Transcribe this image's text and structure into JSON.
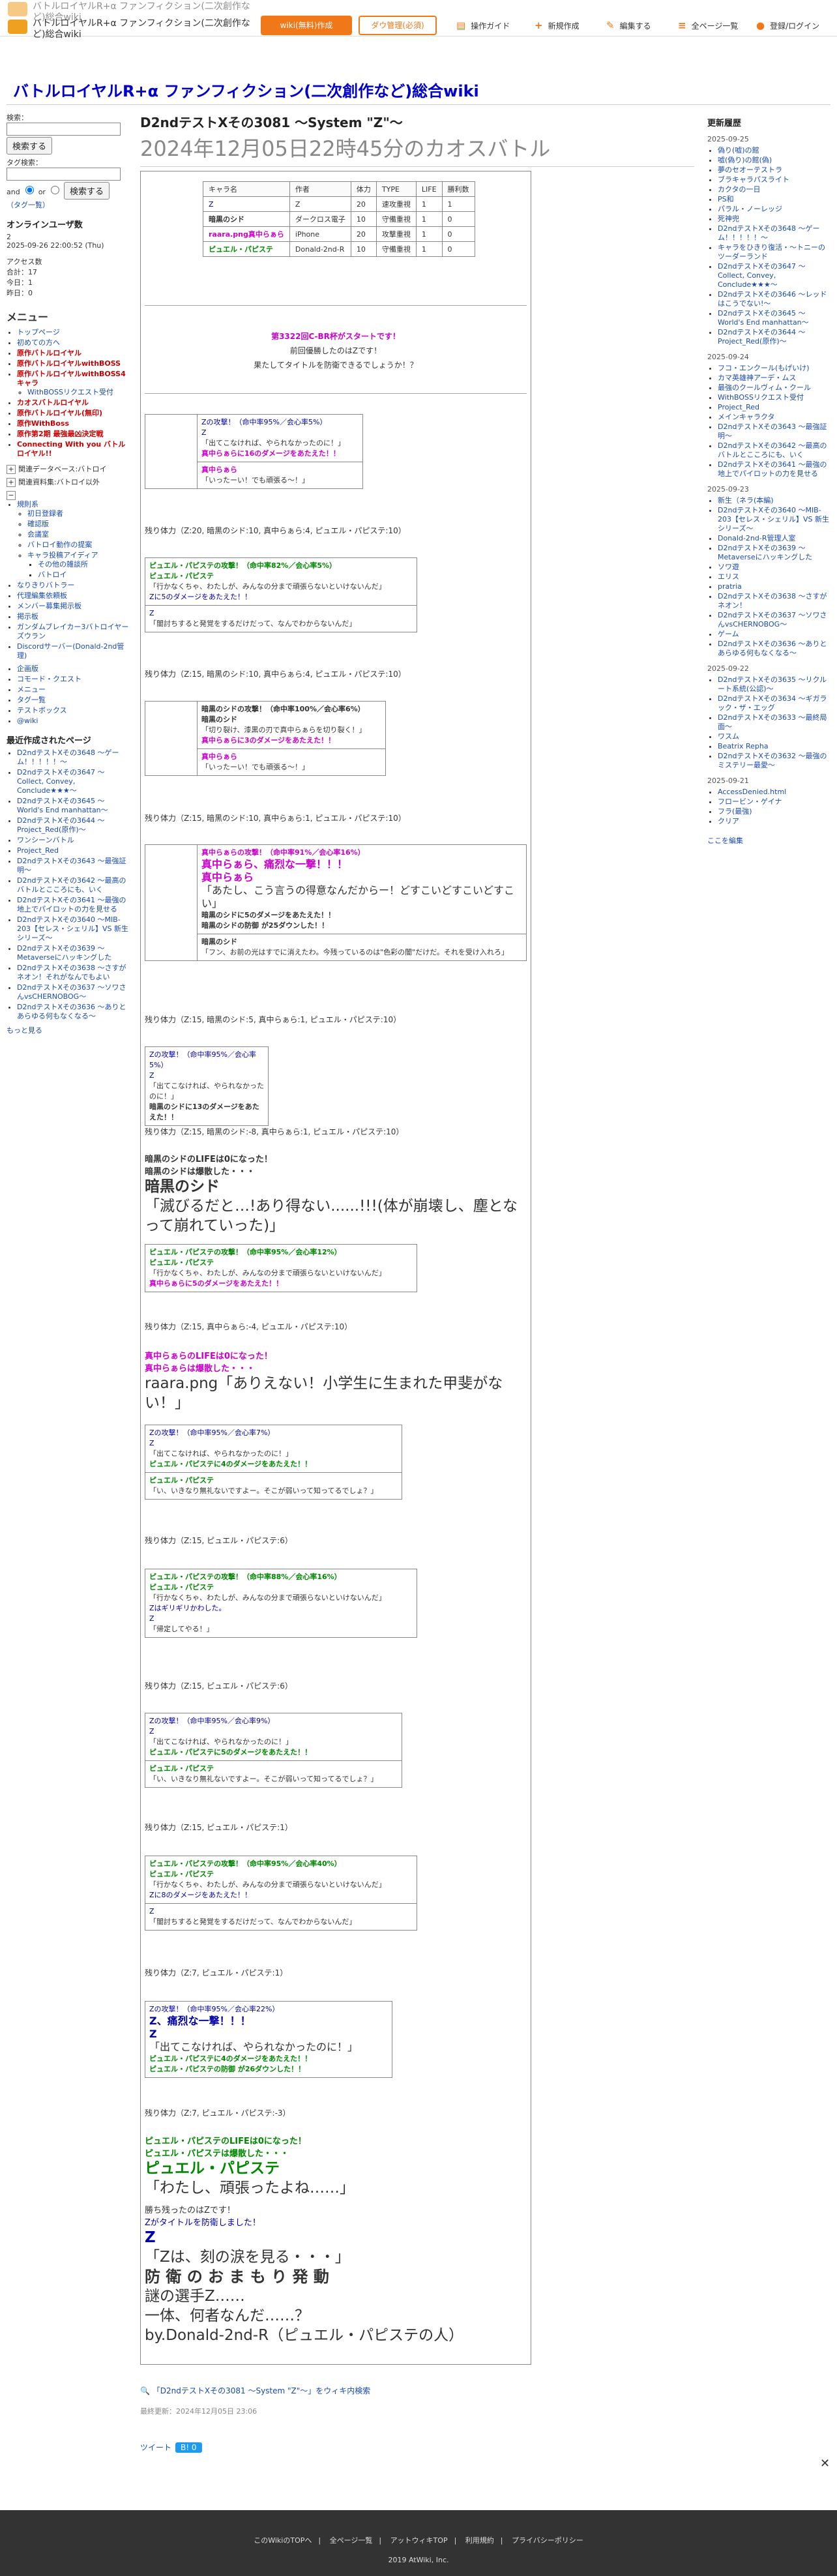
{
  "header": {
    "site_name": "バトルロイヤルR+α ファンフィクション(二次創作など)総合wiki",
    "wiki_new": "wiki(無料)作成",
    "admin": "ダウ管理(必須)",
    "guide": "操作ガイド",
    "new_page": "新規作成",
    "edit": "編集する",
    "all_pages": "全ページ一覧",
    "login": "登録/ログイン"
  },
  "site_title": "バトルロイヤルR+α ファンフィクション(二次創作など)総合wiki",
  "left": {
    "search_label": "検索：",
    "search_button": "検索する",
    "tag_search_label": "タグ検索：",
    "and": "and",
    "or": "or",
    "tag_search_button": "検索する",
    "tag_list": "（タグ一覧）",
    "online_title": "オンラインユーザ数",
    "online_count": "2",
    "online_time": "2025-09-26 22:00:52 (Thu)",
    "access_title": "アクセス数",
    "access_total": "合計：17",
    "access_today": "今日：1",
    "access_yesterday": "昨日：0",
    "menu_title": "メニュー",
    "menu_items": [
      "トップページ",
      "初めての方へ",
      "原作バトルロイヤル",
      "原作バトルロイヤルwithBOSS",
      "原作バトルロイヤルwithBOSS4キャラ",
      "WithBOSSリクエスト受付",
      "カオスバトルロイヤル",
      "原作バトルロイヤル(無印)",
      "原作WithBoss",
      "原作第2期 最強最凶決定戦",
      "Connecting With you バトルロイヤル!!"
    ],
    "menu_related1": "関連データベース:バトロイ",
    "menu_related2": "関連資料集:バトロイ以外",
    "fold_items": [
      "規則系",
      "初日登録者",
      "確認版",
      "会議室",
      "バトロイ動作の提案",
      "キャラ投稿アイディア",
      "その他の雑談所",
      "バトロイ"
    ],
    "misc_items": [
      "なりきりバトラー",
      "代理編集依頼板",
      "メンバー募集掲示板",
      "掲示板",
      "ガンダムブレイカー3バトロイヤーズウラン",
      "Discordサーバー(Donald-2nd管理)"
    ],
    "bottom_items": [
      "企画版",
      "コモード・クエスト",
      "メニュー",
      "タグ一覧",
      "テストボックス",
      "@wiki"
    ],
    "recent_title": "最近作成されたページ",
    "recent_items": [
      "D2ndテストXその3648 〜ゲーム！！！！！〜",
      "D2ndテストXその3647 〜Collect, Convey, Conclude★★★〜",
      "D2ndテストXその3645 〜World's End manhattan〜",
      "D2ndテストXその3644 〜Project_Red(原作)〜",
      "ワンシーンバトル",
      "Project_Red",
      "D2ndテストXその3643 〜最強証明〜",
      "D2ndテストXその3642 〜最高のバトルとこころにも、いく",
      "D2ndテストXその3641 〜最強の地上でパイロットの力を見せる",
      "D2ndテストXその3640 〜MIB-203【セレス・シェリル】VS 新生シリーズ〜",
      "D2ndテストXその3639 〜Metaverseにハッキングした",
      "D2ndテストXその3638 〜さすがネオン！それがなんでもよい",
      "D2ndテストXその3637 〜ソワさんvsCHERNOBOG〜",
      "D2ndテストXその3636 〜ありとあらゆる何もなくなる〜"
    ],
    "more": "もっと見る"
  },
  "page": {
    "title_en": "D2ndテストXその3081 〜System \"Z\"〜",
    "title_jp": "2024年12月05日22時45分のカオスバトル"
  },
  "stats_table": {
    "headers": [
      "キャラ名",
      "作者",
      "体力",
      "TYPE",
      "LIFE",
      "勝利数"
    ],
    "rows": [
      [
        "Z",
        "Z",
        "20",
        "速攻重視",
        "1",
        "1"
      ],
      [
        "暗黒のシド",
        "ダークロス電子",
        "10",
        "守備重視",
        "1",
        "0"
      ],
      [
        "raara.png真中らぁら",
        "iPhone",
        "20",
        "攻撃重視",
        "1",
        "0"
      ],
      [
        "ピュエル・パピステ",
        "Donald-2nd-R",
        "10",
        "守備重視",
        "1",
        "0"
      ]
    ]
  },
  "intro": {
    "line1": "第3322回C-BR杯がスタートです！",
    "line2": "前回優勝したのはZです！",
    "line3": "果たしてタイトルを防衛できるでしょうか！？"
  },
  "battle": {
    "t1_a": "Zの攻撃！（命中率95%／会心率5%）",
    "t1_b": "Z",
    "t1_c": "「出てこなければ、やられなかったのに！」",
    "t1_d": "真中らぁらに16のダメージをあたえた！！",
    "t1_e": "真中らぁら",
    "t1_f": "「いったーい！でも頑張る～！」",
    "hp1": "残り体力（Z:20, 暗黒のシド:10, 真中らぁら:4, ピュエル・パピステ:10）",
    "t2_a": "ピュエル・パピステの攻撃！（命中率82%／会心率5%）",
    "t2_b": "ピュエル・パピステ",
    "t2_c": "「行かなくちゃ、わたしが、みんなの分まで頑張らないといけないんだ」",
    "t2_d": "Zに5のダメージをあたえた！！",
    "t2_e": "Z",
    "t2_f": "「闇討ちすると発覚をするだけだって、なんでわからないんだ」",
    "hp2": "残り体力（Z:15, 暗黒のシド:10, 真中らぁら:4, ピュエル・パピステ:10）",
    "t3_a": "暗黒のシドの攻撃！（命中率100%／会心率6%）",
    "t3_b": "暗黒のシド",
    "t3_c": "「切り裂け、漆黒の刃で真中らぁらを切り裂く！」",
    "t3_d": "真中らぁらに3のダメージをあたえた！！",
    "t3_e": "真中らぁら",
    "t3_f": "「いったーい！でも頑張る～！」",
    "hp3": "残り体力（Z:15, 暗黒のシド:10, 真中らぁら:1, ピュエル・パピステ:10）",
    "t4_a": "真中らぁらの攻撃！（命中率91%／会心率16%）",
    "t4_b": "真中らぁら、痛烈な一撃！！！",
    "t4_c": "真中らぁら",
    "t4_d": "「あたし、こう言うの得意なんだからー！どすこいどすこいどすこい」",
    "t4_e": "暗黒のシドに5のダメージをあたえた！！",
    "t4_f": "暗黒のシドの防御 が25ダウンした！！",
    "t4_g": "暗黒のシド",
    "t4_h": "「フン、お前の光はすでに消えたわ。今残っているのは\"色彩の闇\"だけだ。それを受け入れろ」",
    "hp4": "残り体力（Z:15, 暗黒のシド:5, 真中らぁら:1, ピュエル・パピステ:10）",
    "t5_a": "Zの攻撃！（命中率95%／会心率5%）",
    "t5_b": "Z",
    "t5_c": "「出てこなければ、やられなかったのに！」",
    "t5_d": "暗黒のシドに13のダメージをあたえた！！",
    "hp5": "残り体力（Z:15, 暗黒のシド:-8, 真中らぁら:1, ピュエル・パピステ:10）",
    "d1_a": "暗黒のシドのLIFEは0になった！",
    "d1_b": "暗黒のシドは爆散した・・・",
    "d1_c": "暗黒のシド",
    "d1_d": "「滅びるだと…!あり得ない......!!!(体が崩壊し、塵となって崩れていった)」",
    "t6_a": "ピュエル・パピステの攻撃！（命中率95%／会心率12%）",
    "t6_b": "ピュエル・パピステ",
    "t6_c": "「行かなくちゃ、わたしが、みんなの分まで頑張らないといけないんだ」",
    "t6_d": "真中らぁらに5のダメージをあたえた！！",
    "hp6": "残り体力（Z:15, 真中らぁら:-4, ピュエル・パピステ:10）",
    "d2_a": "真中らぁらのLIFEは0になった！",
    "d2_b": "真中らぁらは爆散した・・・",
    "d2_c": "raara.png「ありえない！小学生に生まれた甲斐がない！」",
    "t7_a": "Zの攻撃！（命中率95%／会心率7%）",
    "t7_b": "Z",
    "t7_c": "「出てこなければ、やられなかったのに！」",
    "t7_d": "ピュエル・パピステに4のダメージをあたえた！！",
    "t7_e": "ピュエル・パピステ",
    "t7_f": "「い、いきなり無礼ないですよー。そこが弱いって知ってるでしょ？」",
    "hp7": "残り体力（Z:15, ピュエル・パピステ:6）",
    "t8_a": "ピュエル・パピステの攻撃！（命中率88%／会心率16%）",
    "t8_b": "ピュエル・パピステ",
    "t8_c": "「行かなくちゃ、わたしが、みんなの分まで頑張らないといけないんだ」",
    "t8_d": "Zはギリギリかわした。",
    "t8_e": "Z",
    "t8_f": "「帰定してやる！」",
    "hp8": "残り体力（Z:15, ピュエル・パピステ:6）",
    "t9_a": "Zの攻撃！（命中率95%／会心率9%）",
    "t9_b": "Z",
    "t9_c": "「出てこなければ、やられなかったのに！」",
    "t9_d": "ピュエル・パピステに5のダメージをあたえた！！",
    "t9_e": "ピュエル・パピステ",
    "t9_f": "「い、いきなり無礼ないですよー。そこが弱いって知ってるでしょ？」",
    "hp9": "残り体力（Z:15, ピュエル・パピステ:1）",
    "t10_a": "ピュエル・パピステの攻撃！（命中率95%／会心率40%）",
    "t10_b": "ピュエル・パピステ",
    "t10_c": "「行かなくちゃ、わたしが、みんなの分まで頑張らないといけないんだ」",
    "t10_d": "Zに8のダメージをあたえた！！",
    "t10_e": "Z",
    "t10_f": "「闇討ちすると発覚をするだけだって、なんでわからないんだ」",
    "hp10": "残り体力（Z:7, ピュエル・パピステ:1）",
    "t11_a": "Zの攻撃！（命中率95%／会心率22%）",
    "t11_b": "Z、痛烈な一撃！！！",
    "t11_c": "Z",
    "t11_d": "「出てこなければ、やられなかったのに！」",
    "t11_e": "ピュエル・パピステに4のダメージをあたえた！！",
    "t11_f": "ピュエル・パピステの防御 が26ダウンした！！",
    "hp11": "残り体力（Z:7, ピュエル・パピステ:-3）",
    "d3_a": "ピュエル・パピステのLIFEは0になった！",
    "d3_b": "ピュエル・パピステは爆散した・・・",
    "d3_c": "ピュエル・パピステ",
    "d3_d": "「わたし、頑張ったよね……」",
    "end_a": "勝ち残ったのはZです！",
    "end_b": "Zがタイトルを防衛しました！",
    "end_c": "Z",
    "end_d": "「Zは、刻の涙を見る・・・」",
    "end_e": "防 衛 の お ま も り 発 動",
    "end_f": "謎の選手Z……",
    "end_g": "一体、何者なんだ……？",
    "end_h": "by.Donald-2nd-R（ピュエル・パピステの人）"
  },
  "footer_links": {
    "bottom_link": "「D2ndテストXその3081 〜System \"Z\"〜」をウィキ内検索",
    "updated": "最終更新：2024年12月05日 23:06",
    "tweet": "ツイート",
    "tweet_count": "B! 0"
  },
  "right": {
    "title": "更新履歴",
    "groups": [
      {
        "date": "2025-09-25",
        "items": [
          "偽り(嘘)の館",
          "嘘(偽り)の館(偽)",
          "夢のセオーテストラ",
          "ブラキャラパスライト",
          "カクタの一日",
          "PS和",
          "パラル・ノーレッジ",
          "死神兜",
          "D2ndテストXその3648 〜ゲーム！！！！！〜",
          "キャラをひきり復活・〜トニーのツーダーランド",
          "D2ndテストXその3647 〜Collect, Convey, Conclude★★★〜",
          "D2ndテストXその3646 〜レッドはこうでない!〜",
          "D2ndテストXその3645 〜World's End manhattan〜",
          "D2ndテストXその3644 〜Project_Red(原作)〜"
        ]
      },
      {
        "date": "2025-09-24",
        "items": [
          "フコ・エンクール(もげいけ)",
          "カマ英雄神アーデ・ムス",
          "最強のクールヴィム・クール",
          "WithBOSSリクエスト受付",
          "Project_Red",
          "メインキャラクタ",
          "D2ndテストXその3643 〜最強証明〜",
          "D2ndテストXその3642 〜最高のバトルとこころにも、いく",
          "D2ndテストXその3641 〜最強の地上でパイロットの力を見せる"
        ]
      },
      {
        "date": "2025-09-23",
        "items": [
          "新生（ネラ(本編)",
          "D2ndテストXその3640 〜MIB-203【セレス・シェリル】VS 新生シリーズ〜",
          "Donald-2nd-R管理人室",
          "D2ndテストXその3639 〜Metaverseにハッキングした",
          "ソワ遊",
          "エリス",
          "pratria",
          "D2ndテストXその3638 〜さすがネオン！",
          "D2ndテストXその3637 〜ソワさんvsCHERNOBOG〜",
          "ゲーム",
          "D2ndテストXその3636 〜ありとあらゆる何もなくなる〜"
        ]
      },
      {
        "date": "2025-09-22",
        "items": [
          "D2ndテストXその3635 〜リクルート系統(公認)〜",
          "D2ndテストXその3634 〜ギガラック・ザ・エッグ",
          "D2ndテストXその3633 〜最終局面〜",
          "ワスム",
          "Beatrix Repha",
          "D2ndテストXその3632 〜最強のミステリー最愛〜"
        ]
      },
      {
        "date": "2025-09-21",
        "items": [
          "AccessDenied.html",
          "フロービン・ゲイナ",
          "フラ(最強)",
          "クリア"
        ]
      }
    ],
    "edit_here": "ここを編集"
  },
  "footer": {
    "links": [
      "このWikiのTOPへ",
      "全ページ一覧",
      "アットウィキTOP",
      "利用規約",
      "プライバシーポリシー"
    ],
    "copyright": "2019 AtWiki, Inc."
  }
}
